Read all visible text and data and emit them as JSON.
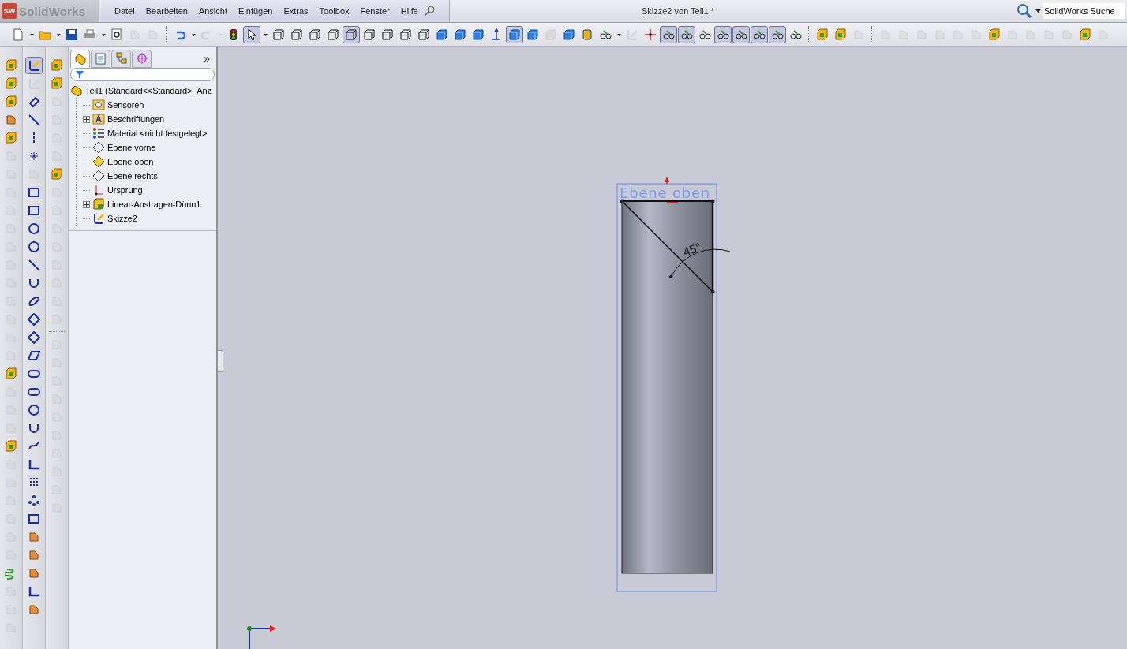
{
  "app": {
    "logo_mark": "SW",
    "logo": "SolidWorks"
  },
  "menu": [
    "Datei",
    "Bearbeiten",
    "Ansicht",
    "Einfügen",
    "Extras",
    "Toolbox",
    "Fenster",
    "Hilfe"
  ],
  "window": {
    "title": "Skizze2 von Teil1 *"
  },
  "search": {
    "placeholder": "SolidWorks Suche"
  },
  "toolbar": [
    {
      "kind": "page",
      "pressed": false,
      "disabled": false
    },
    {
      "kind": "caret",
      "pressed": false,
      "disabled": false
    },
    {
      "kind": "folder",
      "pressed": false,
      "disabled": false
    },
    {
      "kind": "caret",
      "pressed": false,
      "disabled": false
    },
    {
      "kind": "floppy",
      "pressed": false,
      "disabled": false
    },
    {
      "kind": "printer",
      "pressed": false,
      "disabled": false
    },
    {
      "kind": "caret",
      "pressed": false,
      "disabled": false
    },
    {
      "kind": "magnifier",
      "pressed": false,
      "disabled": false
    },
    {
      "kind": "tool",
      "pressed": false,
      "disabled": true
    },
    {
      "kind": "tool",
      "pressed": false,
      "disabled": true
    },
    {
      "kind": "separator"
    },
    {
      "kind": "undo",
      "pressed": false,
      "disabled": false
    },
    {
      "kind": "caret",
      "pressed": false,
      "disabled": false
    },
    {
      "kind": "redo",
      "pressed": false,
      "disabled": true
    },
    {
      "kind": "caret",
      "pressed": false,
      "disabled": true
    },
    {
      "kind": "traffic-light",
      "pressed": false,
      "disabled": false
    },
    {
      "kind": "cursor",
      "pressed": true,
      "disabled": false
    },
    {
      "kind": "caret",
      "pressed": false,
      "disabled": false
    },
    {
      "kind": "wire-cube",
      "pressed": false,
      "disabled": false
    },
    {
      "kind": "wire-cube",
      "pressed": false,
      "disabled": false
    },
    {
      "kind": "wire-cube",
      "pressed": false,
      "disabled": false
    },
    {
      "kind": "wire-cube",
      "pressed": false,
      "disabled": false
    },
    {
      "kind": "wire-cube",
      "pressed": true,
      "disabled": false
    },
    {
      "kind": "wire-cube",
      "pressed": false,
      "disabled": false
    },
    {
      "kind": "wire-cube",
      "pressed": false,
      "disabled": false
    },
    {
      "kind": "wire-cube",
      "pressed": false,
      "disabled": false
    },
    {
      "kind": "wire-cube",
      "pressed": false,
      "disabled": false
    },
    {
      "kind": "cube",
      "pressed": false,
      "disabled": false
    },
    {
      "kind": "cube",
      "pressed": false,
      "disabled": false
    },
    {
      "kind": "cube",
      "pressed": false,
      "disabled": false
    },
    {
      "kind": "axis",
      "pressed": false,
      "disabled": false
    },
    {
      "kind": "cube",
      "pressed": true,
      "disabled": false
    },
    {
      "kind": "cube",
      "pressed": false,
      "disabled": false
    },
    {
      "kind": "cube",
      "pressed": false,
      "disabled": true
    },
    {
      "kind": "cube",
      "pressed": false,
      "disabled": false
    },
    {
      "kind": "cylinder",
      "pressed": false,
      "disabled": false
    },
    {
      "kind": "glasses",
      "pressed": false,
      "disabled": false
    },
    {
      "kind": "caret",
      "pressed": false,
      "disabled": false
    },
    {
      "kind": "pencil",
      "pressed": false,
      "disabled": true
    },
    {
      "kind": "move",
      "pressed": false,
      "disabled": false
    },
    {
      "kind": "glasses",
      "pressed": true,
      "disabled": false
    },
    {
      "kind": "glasses",
      "pressed": true,
      "disabled": false
    },
    {
      "kind": "glasses",
      "pressed": false,
      "disabled": false
    },
    {
      "kind": "glasses",
      "pressed": true,
      "disabled": false
    },
    {
      "kind": "glasses",
      "pressed": true,
      "disabled": false
    },
    {
      "kind": "glasses",
      "pressed": true,
      "disabled": false
    },
    {
      "kind": "glasses",
      "pressed": true,
      "disabled": false
    },
    {
      "kind": "glasses",
      "pressed": false,
      "disabled": false
    },
    {
      "kind": "separator"
    },
    {
      "kind": "block",
      "pressed": false,
      "disabled": false
    },
    {
      "kind": "block",
      "pressed": false,
      "disabled": false
    },
    {
      "kind": "tool",
      "pressed": false,
      "disabled": true
    },
    {
      "kind": "separator"
    },
    {
      "kind": "tool",
      "pressed": false,
      "disabled": true
    },
    {
      "kind": "tool",
      "pressed": false,
      "disabled": true
    },
    {
      "kind": "tool",
      "pressed": false,
      "disabled": true
    },
    {
      "kind": "tool",
      "pressed": false,
      "disabled": true
    },
    {
      "kind": "tool",
      "pressed": false,
      "disabled": true
    },
    {
      "kind": "tool",
      "pressed": false,
      "disabled": true
    },
    {
      "kind": "block",
      "pressed": false,
      "disabled": false
    },
    {
      "kind": "tool",
      "pressed": false,
      "disabled": true
    },
    {
      "kind": "tool",
      "pressed": false,
      "disabled": true
    },
    {
      "kind": "tool",
      "pressed": false,
      "disabled": true
    },
    {
      "kind": "tool",
      "pressed": false,
      "disabled": true
    },
    {
      "kind": "block",
      "pressed": false,
      "disabled": false
    },
    {
      "kind": "tool",
      "pressed": false,
      "disabled": true
    }
  ],
  "side_toolbars": [
    {
      "buttons": [
        {
          "kind": "block",
          "pressed": false,
          "disabled": false
        },
        {
          "kind": "block",
          "pressed": false,
          "disabled": false
        },
        {
          "kind": "block",
          "pressed": false,
          "disabled": false
        },
        {
          "kind": "tool",
          "pressed": false,
          "disabled": false
        },
        {
          "kind": "block",
          "pressed": false,
          "disabled": false
        },
        {
          "kind": "tool",
          "pressed": false,
          "disabled": true
        },
        {
          "kind": "tool",
          "pressed": false,
          "disabled": true
        },
        {
          "kind": "tool",
          "pressed": false,
          "disabled": true
        },
        {
          "kind": "tool",
          "pressed": false,
          "disabled": true
        },
        {
          "kind": "tool",
          "pressed": false,
          "disabled": true
        },
        {
          "kind": "tool",
          "pressed": false,
          "disabled": true
        },
        {
          "kind": "tool",
          "pressed": false,
          "disabled": true
        },
        {
          "kind": "tool",
          "pressed": false,
          "disabled": true
        },
        {
          "kind": "tool",
          "pressed": false,
          "disabled": true
        },
        {
          "kind": "tool",
          "pressed": false,
          "disabled": true
        },
        {
          "kind": "tool",
          "pressed": false,
          "disabled": true
        },
        {
          "kind": "tool",
          "pressed": false,
          "disabled": true
        },
        {
          "kind": "block",
          "pressed": false,
          "disabled": false
        },
        {
          "kind": "tool",
          "pressed": false,
          "disabled": true
        },
        {
          "kind": "tool",
          "pressed": false,
          "disabled": true
        },
        {
          "kind": "tool",
          "pressed": false,
          "disabled": true
        },
        {
          "kind": "block",
          "pressed": false,
          "disabled": false
        },
        {
          "kind": "tool",
          "pressed": false,
          "disabled": true
        },
        {
          "kind": "tool",
          "pressed": false,
          "disabled": true
        },
        {
          "kind": "tool",
          "pressed": false,
          "disabled": true
        },
        {
          "kind": "tool",
          "pressed": false,
          "disabled": true
        },
        {
          "kind": "tool",
          "pressed": false,
          "disabled": true
        },
        {
          "kind": "tool",
          "pressed": false,
          "disabled": true
        },
        {
          "kind": "spring",
          "pressed": false,
          "disabled": false
        },
        {
          "kind": "tool",
          "pressed": false,
          "disabled": true
        },
        {
          "kind": "tool",
          "pressed": false,
          "disabled": true
        },
        {
          "kind": "tool",
          "pressed": false,
          "disabled": true
        }
      ]
    },
    {
      "buttons": [
        {
          "kind": "pencil",
          "pressed": true,
          "disabled": false
        },
        {
          "kind": "pencil",
          "pressed": false,
          "disabled": true
        },
        {
          "kind": "dimension",
          "pressed": false,
          "disabled": false
        },
        {
          "kind": "line",
          "pressed": false,
          "disabled": false
        },
        {
          "kind": "centerline",
          "pressed": false,
          "disabled": false
        },
        {
          "kind": "point",
          "pressed": false,
          "disabled": false
        },
        {
          "kind": "tool",
          "pressed": false,
          "disabled": true
        },
        {
          "kind": "rectangle",
          "pressed": false,
          "disabled": false
        },
        {
          "kind": "rectangle",
          "pressed": false,
          "disabled": false
        },
        {
          "kind": "circle",
          "pressed": false,
          "disabled": false
        },
        {
          "kind": "circle",
          "pressed": false,
          "disabled": false
        },
        {
          "kind": "line",
          "pressed": false,
          "disabled": false
        },
        {
          "kind": "arc",
          "pressed": false,
          "disabled": false
        },
        {
          "kind": "ellipse",
          "pressed": false,
          "disabled": false
        },
        {
          "kind": "diamond",
          "pressed": false,
          "disabled": false
        },
        {
          "kind": "diamond",
          "pressed": false,
          "disabled": false
        },
        {
          "kind": "parallelogram",
          "pressed": false,
          "disabled": false
        },
        {
          "kind": "slot",
          "pressed": false,
          "disabled": false
        },
        {
          "kind": "slot",
          "pressed": false,
          "disabled": false
        },
        {
          "kind": "circle",
          "pressed": false,
          "disabled": false
        },
        {
          "kind": "arc",
          "pressed": false,
          "disabled": false
        },
        {
          "kind": "spline",
          "pressed": false,
          "disabled": false
        },
        {
          "kind": "corner",
          "pressed": false,
          "disabled": false
        },
        {
          "kind": "grid",
          "pressed": false,
          "disabled": false
        },
        {
          "kind": "dots",
          "pressed": false,
          "disabled": false
        },
        {
          "kind": "rectangle",
          "pressed": false,
          "disabled": false
        },
        {
          "kind": "tool",
          "pressed": false,
          "disabled": false
        },
        {
          "kind": "tool",
          "pressed": false,
          "disabled": false
        },
        {
          "kind": "tool",
          "pressed": false,
          "disabled": false
        },
        {
          "kind": "corner",
          "pressed": false,
          "disabled": false
        },
        {
          "kind": "tool",
          "pressed": false,
          "disabled": false
        }
      ]
    },
    {
      "buttons": [
        {
          "kind": "block",
          "pressed": false,
          "disabled": false
        },
        {
          "kind": "block",
          "pressed": false,
          "disabled": false
        },
        {
          "kind": "tool",
          "pressed": false,
          "disabled": true
        },
        {
          "kind": "tool",
          "pressed": false,
          "disabled": true
        },
        {
          "kind": "tool",
          "pressed": false,
          "disabled": true
        },
        {
          "kind": "tool",
          "pressed": false,
          "disabled": true
        },
        {
          "kind": "block",
          "pressed": false,
          "disabled": false
        },
        {
          "kind": "tool",
          "pressed": false,
          "disabled": true
        },
        {
          "kind": "tool",
          "pressed": false,
          "disabled": true
        },
        {
          "kind": "tool",
          "pressed": false,
          "disabled": true
        },
        {
          "kind": "tool",
          "pressed": false,
          "disabled": true
        },
        {
          "kind": "tool",
          "pressed": false,
          "disabled": true
        },
        {
          "kind": "tool",
          "pressed": false,
          "disabled": true
        },
        {
          "kind": "tool",
          "pressed": false,
          "disabled": true
        },
        {
          "kind": "tool",
          "pressed": false,
          "disabled": true
        },
        {
          "kind": "separator"
        },
        {
          "kind": "tool",
          "pressed": false,
          "disabled": true
        },
        {
          "kind": "tool",
          "pressed": false,
          "disabled": true
        },
        {
          "kind": "tool",
          "pressed": false,
          "disabled": true
        },
        {
          "kind": "tool",
          "pressed": false,
          "disabled": true
        },
        {
          "kind": "tool",
          "pressed": false,
          "disabled": true
        },
        {
          "kind": "tool",
          "pressed": false,
          "disabled": true
        },
        {
          "kind": "tool",
          "pressed": false,
          "disabled": true
        },
        {
          "kind": "tool",
          "pressed": false,
          "disabled": true
        },
        {
          "kind": "tool",
          "pressed": false,
          "disabled": true
        },
        {
          "kind": "tool",
          "pressed": false,
          "disabled": true
        }
      ]
    }
  ],
  "panel": {
    "tabs": [
      {
        "kind": "tree",
        "selected": true
      },
      {
        "kind": "properties",
        "selected": false
      },
      {
        "kind": "config",
        "selected": false
      },
      {
        "kind": "target",
        "selected": false
      }
    ],
    "more": "»",
    "tree": [
      {
        "label": "Teil1  (Standard<<Standard>_Anz",
        "kind": "part",
        "children": [
          {
            "label": "Sensoren",
            "kind": "sensor",
            "expandable": false
          },
          {
            "label": "Beschriftungen",
            "kind": "annotation",
            "expandable": true
          },
          {
            "label": "Material <nicht festgelegt>",
            "kind": "material",
            "expandable": false
          },
          {
            "label": "Ebene vorne",
            "kind": "plane",
            "expandable": false
          },
          {
            "label": "Ebene oben",
            "kind": "plane-active",
            "expandable": false
          },
          {
            "label": "Ebene rechts",
            "kind": "plane",
            "expandable": false
          },
          {
            "label": "Ursprung",
            "kind": "origin",
            "expandable": false
          },
          {
            "label": "Linear-Austragen-Dünn1",
            "kind": "feature",
            "expandable": true
          },
          {
            "label": "Skizze2",
            "kind": "sketch",
            "expandable": false
          }
        ]
      }
    ]
  },
  "viewport": {
    "plane_label": "Ebene oben",
    "dimension": "45°"
  }
}
